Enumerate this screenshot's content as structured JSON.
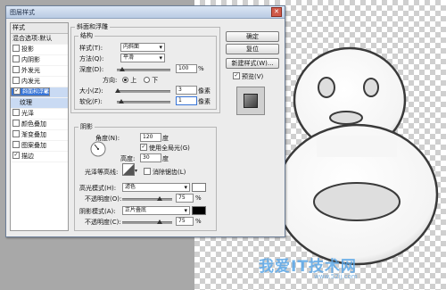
{
  "dialog": {
    "title": "图层样式"
  },
  "styles_panel": {
    "header": "样式",
    "items": [
      {
        "label": "混合选项:默认",
        "kind": "blend",
        "checked": false
      },
      {
        "label": "投影",
        "kind": "item",
        "checked": false
      },
      {
        "label": "内阴影",
        "kind": "item",
        "checked": false
      },
      {
        "label": "外发光",
        "kind": "item",
        "checked": false
      },
      {
        "label": "内发光",
        "kind": "item",
        "checked": false
      },
      {
        "label": "斜面和浮雕",
        "kind": "selected",
        "checked": true
      },
      {
        "label": "等高线",
        "kind": "sub",
        "checked": false
      },
      {
        "label": "纹理",
        "kind": "sub",
        "checked": false
      },
      {
        "label": "光泽",
        "kind": "item",
        "checked": false
      },
      {
        "label": "颜色叠加",
        "kind": "item",
        "checked": false
      },
      {
        "label": "渐变叠加",
        "kind": "item",
        "checked": false
      },
      {
        "label": "图案叠加",
        "kind": "item",
        "checked": false
      },
      {
        "label": "描边",
        "kind": "item",
        "checked": true
      }
    ]
  },
  "bevel": {
    "section_title": "斜面和浮雕",
    "structure_title": "结构",
    "style_label": "样式(T):",
    "style_value": "内斜面",
    "technique_label": "方法(Q):",
    "technique_value": "平滑",
    "depth_label": "深度(D):",
    "depth_value": "100",
    "depth_unit": "%",
    "depth_level": 0.1,
    "direction_label": "方向:",
    "direction_up": "上",
    "direction_down": "下",
    "direction_selected": "上",
    "size_label": "大小(Z):",
    "size_value": "3",
    "size_unit": "像素",
    "size_level": 0.02,
    "soften_label": "软化(F):",
    "soften_value": "1",
    "soften_unit": "像素",
    "soften_level": 0.08
  },
  "shading": {
    "title": "阴影",
    "angle_label": "角度(N):",
    "angle_value": "120",
    "angle_unit": "度",
    "global_light_label": "使用全局光(G)",
    "global_light_checked": true,
    "altitude_label": "高度:",
    "altitude_value": "30",
    "altitude_unit": "度",
    "gloss_contour_label": "光泽等高线:",
    "anti_aliased_label": "消除锯齿(L)",
    "anti_aliased_checked": false,
    "highlight_mode_label": "高光模式(H):",
    "highlight_mode_value": "滤色",
    "highlight_color": "#ffffff",
    "highlight_opacity_label": "不透明度(O):",
    "highlight_opacity_value": "75",
    "highlight_opacity_unit": "%",
    "highlight_opacity_level": 0.75,
    "shadow_mode_label": "阴影模式(A):",
    "shadow_mode_value": "正片叠底",
    "shadow_color": "#000000",
    "shadow_opacity_label": "不透明度(C):",
    "shadow_opacity_value": "75",
    "shadow_opacity_unit": "%",
    "shadow_opacity_level": 0.75
  },
  "buttons": {
    "ok": "确定",
    "cancel": "复位",
    "new_style": "新建样式(W)...",
    "preview_label": "预览(V)",
    "preview_checked": true
  },
  "watermark": {
    "text": "我爱IT技术网",
    "url": "www.52ij.com"
  }
}
